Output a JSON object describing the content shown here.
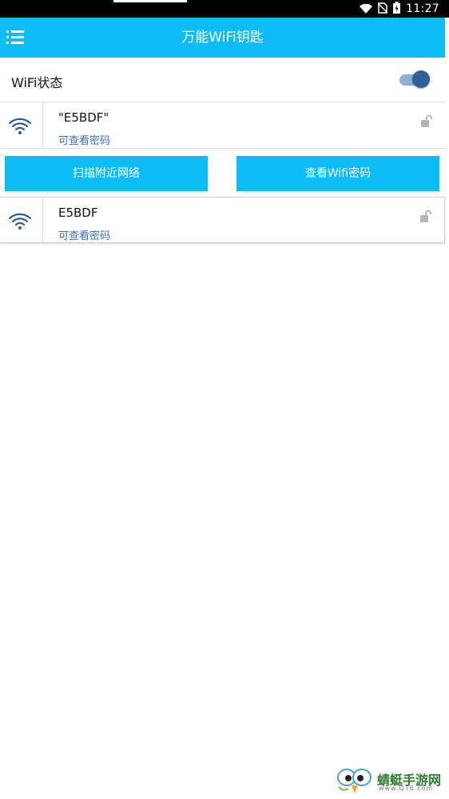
{
  "status_bar": {
    "time": "11:27",
    "icons": [
      "wifi-signal-icon",
      "no-sim-icon",
      "battery-charging-icon"
    ]
  },
  "app_bar": {
    "menu_icon": "list-menu-icon",
    "title": "万能WiFi钥匙"
  },
  "wifi_status": {
    "label": "WiFi状态",
    "toggle_on": true,
    "accent": "#2f5e9a"
  },
  "networks": [
    {
      "ssid": "\"E5BDF\"",
      "hint": "可查看密码",
      "icon": "wifi-icon",
      "lock": "unlocked-lock-icon"
    },
    {
      "ssid": "E5BDF",
      "hint": "可查看密码",
      "icon": "wifi-icon",
      "lock": "unlocked-lock-icon"
    }
  ],
  "actions": {
    "scan_label": "扫描附近网络",
    "view_label": "查看Wifi密码"
  },
  "watermark": {
    "text": "蜻蜓手游网",
    "sub": "www.QT6.com"
  },
  "colors": {
    "primary": "#0cbcf6",
    "link": "#3a6fb8"
  }
}
